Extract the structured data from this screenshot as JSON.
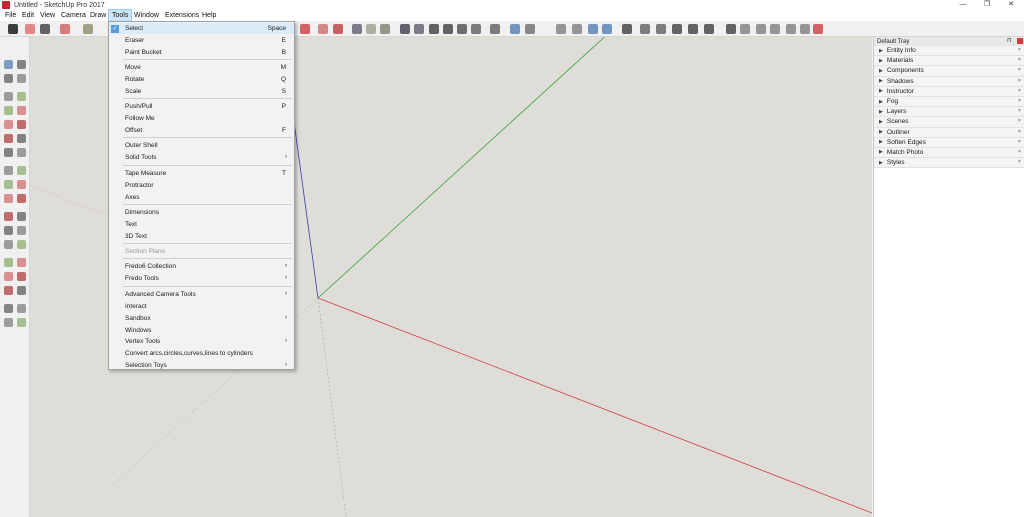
{
  "window": {
    "title": "Untitled - SketchUp Pro 2017",
    "minimize": "—",
    "maximize": "❐",
    "close": "✕"
  },
  "menubar": [
    "File",
    "Edit",
    "View",
    "Camera",
    "Draw",
    "Tools",
    "Window",
    "Extensions",
    "Help"
  ],
  "tools_menu": {
    "items": [
      {
        "label": "Select",
        "shortcut": "Space",
        "checked": true
      },
      {
        "label": "Eraser",
        "shortcut": "E"
      },
      {
        "label": "Paint Bucket",
        "shortcut": "B"
      },
      {
        "label": "Move",
        "shortcut": "M"
      },
      {
        "label": "Rotate",
        "shortcut": "Q"
      },
      {
        "label": "Scale",
        "shortcut": "S"
      },
      {
        "label": "Push/Pull",
        "shortcut": "P"
      },
      {
        "label": "Follow Me",
        "shortcut": ""
      },
      {
        "label": "Offset",
        "shortcut": "F"
      },
      {
        "label": "Outer Shell",
        "shortcut": ""
      },
      {
        "label": "Solid Tools",
        "shortcut": "",
        "submenu": true
      },
      {
        "label": "Tape Measure",
        "shortcut": "T"
      },
      {
        "label": "Protractor",
        "shortcut": ""
      },
      {
        "label": "Axes",
        "shortcut": ""
      },
      {
        "label": "Dimensions",
        "shortcut": ""
      },
      {
        "label": "Text",
        "shortcut": ""
      },
      {
        "label": "3D Text",
        "shortcut": ""
      },
      {
        "label": "Section Plane",
        "shortcut": "",
        "disabled": true
      },
      {
        "label": "Fredo6 Collection",
        "shortcut": "",
        "submenu": true
      },
      {
        "label": "Fredo Tools",
        "shortcut": "",
        "submenu": true
      },
      {
        "label": "Advanced Camera Tools",
        "shortcut": "",
        "submenu": true
      },
      {
        "label": "Interact",
        "shortcut": ""
      },
      {
        "label": "Sandbox",
        "shortcut": "",
        "submenu": true
      },
      {
        "label": "Windows",
        "shortcut": ""
      },
      {
        "label": "Vertex Tools",
        "shortcut": "",
        "submenu": true
      },
      {
        "label": "Convert arcs,circles,curves,lines to cylinders",
        "shortcut": ""
      },
      {
        "label": "Selection Toys",
        "shortcut": "",
        "submenu": true
      }
    ],
    "submenu_arrow": "›"
  },
  "tray": {
    "title": "Default Tray",
    "pin": "⊓",
    "expand_arrow": "▶",
    "panel_close": "×",
    "panels": [
      "Entity Info",
      "Materials",
      "Components",
      "Shadows",
      "Instructor",
      "Fog",
      "Layers",
      "Scenes",
      "Outliner",
      "Soften Edges",
      "Match Photo",
      "Styles"
    ]
  },
  "colors": {
    "viewport_bg": "#dfddd8",
    "axis_red": "#d04040",
    "axis_green": "#3fa040",
    "axis_blue": "#3a3ab0",
    "menu_highlight": "#cce4f7"
  }
}
